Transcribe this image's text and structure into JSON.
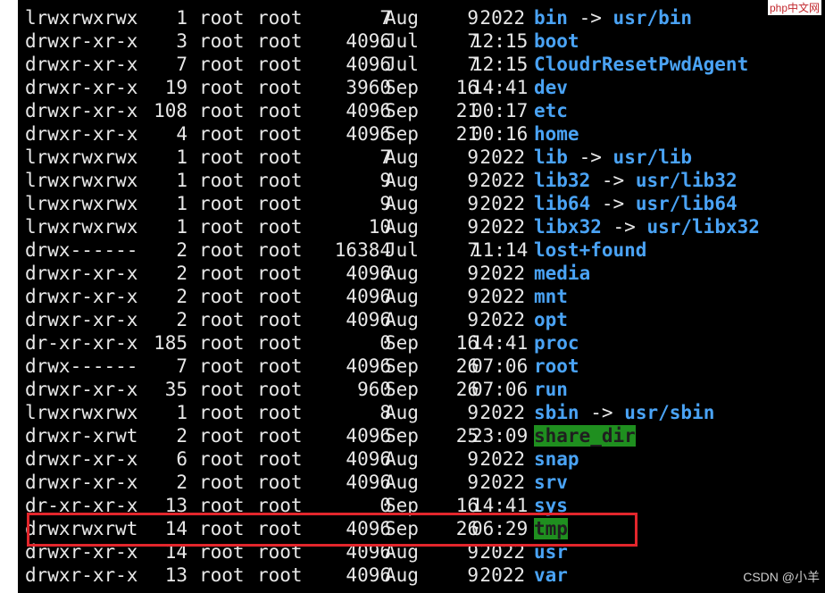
{
  "terminal": {
    "rows": [
      {
        "perm": "lrwxrwxrwx",
        "links": "1",
        "owner": "root",
        "group": "root",
        "size": "7",
        "month": "Aug",
        "day": "9",
        "time": "2022",
        "name": "bin",
        "kind": "link",
        "target": "usr/bin"
      },
      {
        "perm": "drwxr-xr-x",
        "links": "3",
        "owner": "root",
        "group": "root",
        "size": "4096",
        "month": "Jul",
        "day": "7",
        "time": "12:15",
        "name": "boot",
        "kind": "dir",
        "target": ""
      },
      {
        "perm": "drwxr-xr-x",
        "links": "7",
        "owner": "root",
        "group": "root",
        "size": "4096",
        "month": "Jul",
        "day": "7",
        "time": "12:15",
        "name": "CloudrResetPwdAgent",
        "kind": "dir",
        "target": ""
      },
      {
        "perm": "drwxr-xr-x",
        "links": "19",
        "owner": "root",
        "group": "root",
        "size": "3960",
        "month": "Sep",
        "day": "16",
        "time": "14:41",
        "name": "dev",
        "kind": "dir",
        "target": ""
      },
      {
        "perm": "drwxr-xr-x",
        "links": "108",
        "owner": "root",
        "group": "root",
        "size": "4096",
        "month": "Sep",
        "day": "21",
        "time": "00:17",
        "name": "etc",
        "kind": "dir",
        "target": ""
      },
      {
        "perm": "drwxr-xr-x",
        "links": "4",
        "owner": "root",
        "group": "root",
        "size": "4096",
        "month": "Sep",
        "day": "21",
        "time": "00:16",
        "name": "home",
        "kind": "dir",
        "target": ""
      },
      {
        "perm": "lrwxrwxrwx",
        "links": "1",
        "owner": "root",
        "group": "root",
        "size": "7",
        "month": "Aug",
        "day": "9",
        "time": "2022",
        "name": "lib",
        "kind": "link",
        "target": "usr/lib"
      },
      {
        "perm": "lrwxrwxrwx",
        "links": "1",
        "owner": "root",
        "group": "root",
        "size": "9",
        "month": "Aug",
        "day": "9",
        "time": "2022",
        "name": "lib32",
        "kind": "link",
        "target": "usr/lib32"
      },
      {
        "perm": "lrwxrwxrwx",
        "links": "1",
        "owner": "root",
        "group": "root",
        "size": "9",
        "month": "Aug",
        "day": "9",
        "time": "2022",
        "name": "lib64",
        "kind": "link",
        "target": "usr/lib64"
      },
      {
        "perm": "lrwxrwxrwx",
        "links": "1",
        "owner": "root",
        "group": "root",
        "size": "10",
        "month": "Aug",
        "day": "9",
        "time": "2022",
        "name": "libx32",
        "kind": "link",
        "target": "usr/libx32"
      },
      {
        "perm": "drwx------",
        "links": "2",
        "owner": "root",
        "group": "root",
        "size": "16384",
        "month": "Jul",
        "day": "7",
        "time": "11:14",
        "name": "lost+found",
        "kind": "dir",
        "target": ""
      },
      {
        "perm": "drwxr-xr-x",
        "links": "2",
        "owner": "root",
        "group": "root",
        "size": "4096",
        "month": "Aug",
        "day": "9",
        "time": "2022",
        "name": "media",
        "kind": "dir",
        "target": ""
      },
      {
        "perm": "drwxr-xr-x",
        "links": "2",
        "owner": "root",
        "group": "root",
        "size": "4096",
        "month": "Aug",
        "day": "9",
        "time": "2022",
        "name": "mnt",
        "kind": "dir",
        "target": ""
      },
      {
        "perm": "drwxr-xr-x",
        "links": "2",
        "owner": "root",
        "group": "root",
        "size": "4096",
        "month": "Aug",
        "day": "9",
        "time": "2022",
        "name": "opt",
        "kind": "dir",
        "target": ""
      },
      {
        "perm": "dr-xr-xr-x",
        "links": "185",
        "owner": "root",
        "group": "root",
        "size": "0",
        "month": "Sep",
        "day": "16",
        "time": "14:41",
        "name": "proc",
        "kind": "dir",
        "target": ""
      },
      {
        "perm": "drwx------",
        "links": "7",
        "owner": "root",
        "group": "root",
        "size": "4096",
        "month": "Sep",
        "day": "26",
        "time": "07:06",
        "name": "root",
        "kind": "dir",
        "target": ""
      },
      {
        "perm": "drwxr-xr-x",
        "links": "35",
        "owner": "root",
        "group": "root",
        "size": "960",
        "month": "Sep",
        "day": "26",
        "time": "07:06",
        "name": "run",
        "kind": "dir",
        "target": ""
      },
      {
        "perm": "lrwxrwxrwx",
        "links": "1",
        "owner": "root",
        "group": "root",
        "size": "8",
        "month": "Aug",
        "day": "9",
        "time": "2022",
        "name": "sbin",
        "kind": "link",
        "target": "usr/sbin"
      },
      {
        "perm": "drwxr-xrwt",
        "links": "2",
        "owner": "root",
        "group": "root",
        "size": "4096",
        "month": "Sep",
        "day": "25",
        "time": "23:09",
        "name": "share_dir",
        "kind": "sticky",
        "target": ""
      },
      {
        "perm": "drwxr-xr-x",
        "links": "6",
        "owner": "root",
        "group": "root",
        "size": "4096",
        "month": "Aug",
        "day": "9",
        "time": "2022",
        "name": "snap",
        "kind": "dir",
        "target": ""
      },
      {
        "perm": "drwxr-xr-x",
        "links": "2",
        "owner": "root",
        "group": "root",
        "size": "4096",
        "month": "Aug",
        "day": "9",
        "time": "2022",
        "name": "srv",
        "kind": "dir",
        "target": ""
      },
      {
        "perm": "dr-xr-xr-x",
        "links": "13",
        "owner": "root",
        "group": "root",
        "size": "0",
        "month": "Sep",
        "day": "16",
        "time": "14:41",
        "name": "sys",
        "kind": "dir",
        "target": ""
      },
      {
        "perm": "drwxrwxrwt",
        "links": "14",
        "owner": "root",
        "group": "root",
        "size": "4096",
        "month": "Sep",
        "day": "26",
        "time": "06:29",
        "name": "tmp",
        "kind": "sticky",
        "target": ""
      },
      {
        "perm": "drwxr-xr-x",
        "links": "14",
        "owner": "root",
        "group": "root",
        "size": "4096",
        "month": "Aug",
        "day": "9",
        "time": "2022",
        "name": "usr",
        "kind": "dir",
        "target": ""
      },
      {
        "perm": "drwxr-xr-x",
        "links": "13",
        "owner": "root",
        "group": "root",
        "size": "4096",
        "month": "Aug",
        "day": "9",
        "time": "2022",
        "name": "var",
        "kind": "dir",
        "target": ""
      }
    ],
    "link_arrow": "->",
    "highlighted_entry": "tmp"
  },
  "colors": {
    "background": "#000000",
    "text": "#e8e8e8",
    "directory": "#4aa3f5",
    "sticky_dir_background": "#1f8f1f",
    "highlight_box": "#e3262c"
  },
  "watermarks": {
    "top_right": "php中文网",
    "bottom_right": "CSDN @小羊"
  }
}
